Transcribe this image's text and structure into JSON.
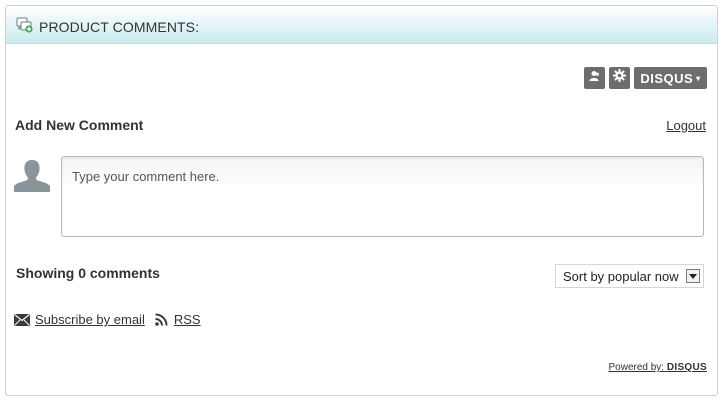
{
  "header": {
    "title": "PRODUCT COMMENTS:",
    "icon": "comments-icon"
  },
  "toolbar": {
    "user_icon": "user-icon",
    "settings_icon": "gear-icon",
    "brand_label": "DISQUS",
    "brand_caret": "▾"
  },
  "add_comment": {
    "title": "Add New Comment",
    "logout_label": "Logout",
    "placeholder": "Type your comment here.",
    "avatar_icon": "avatar-icon"
  },
  "comments": {
    "showing_text": "Showing 0 comments",
    "sort_selected": "Sort by popular now"
  },
  "subscribe": {
    "email_label": "Subscribe by email",
    "rss_label": "RSS"
  },
  "footer": {
    "powered_prefix": "Powered by:",
    "powered_brand": "DISQUS"
  },
  "colors": {
    "header_gradient_end": "#c9eaee",
    "toolbar_bg": "#6d6d6d",
    "border": "#c9d2d6"
  }
}
